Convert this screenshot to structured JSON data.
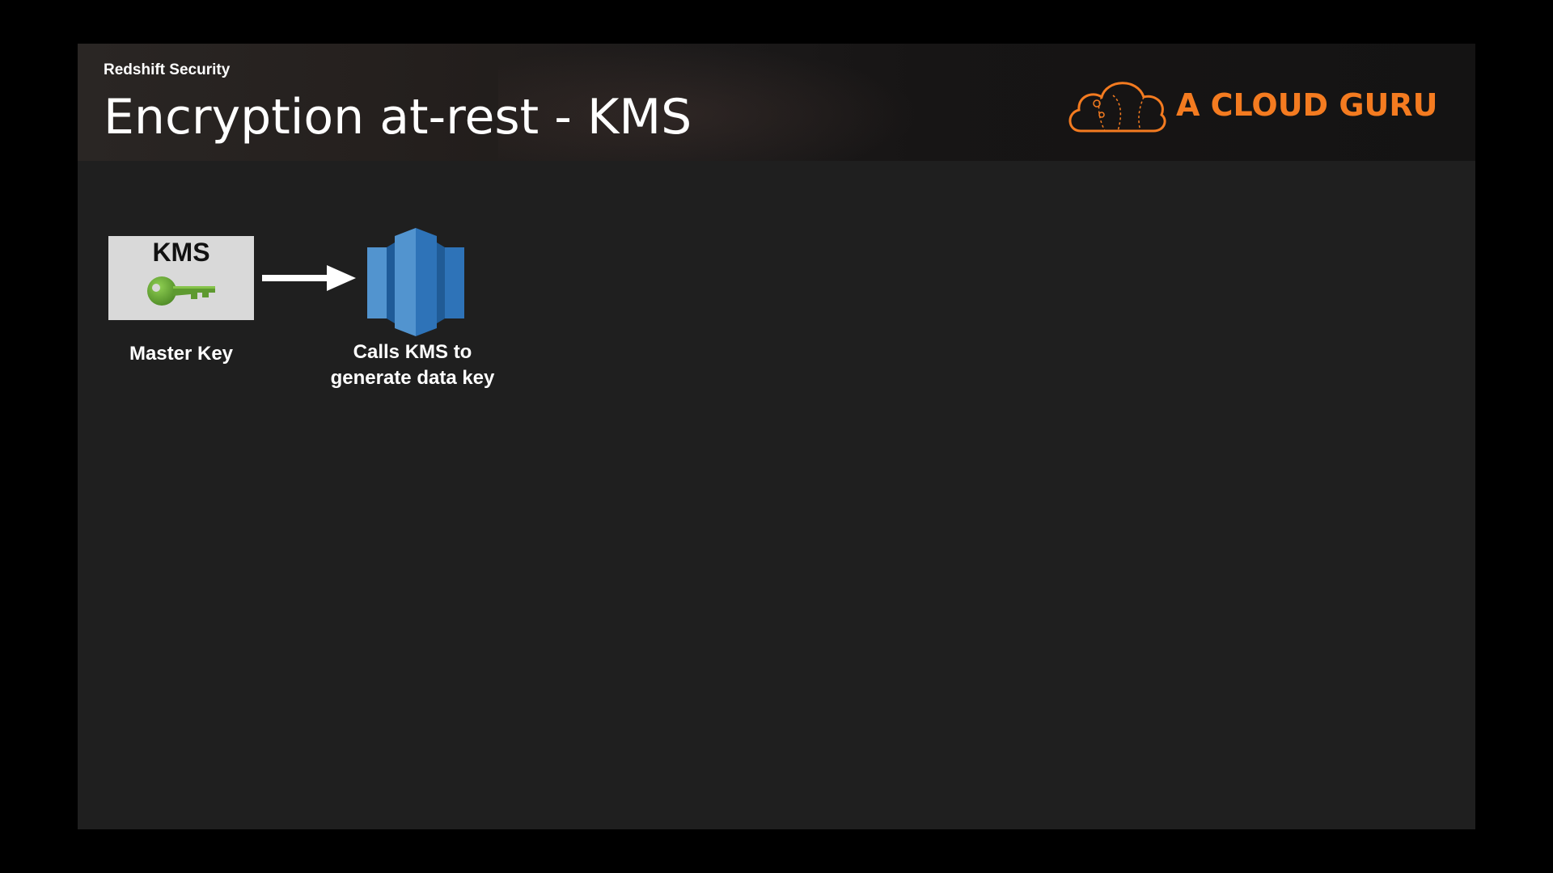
{
  "header": {
    "section_label": "Redshift Security",
    "title": "Encryption at-rest - KMS"
  },
  "logo": {
    "text": "A CLOUD GURU",
    "icon": "cloud-logo-icon",
    "color": "#f47b20"
  },
  "diagram": {
    "kms_box": {
      "title": "KMS",
      "icon": "key-icon",
      "icon_color": "#6aa838",
      "label": "Master Key"
    },
    "arrow": {
      "icon": "right-arrow-icon",
      "color": "#ffffff"
    },
    "redshift": {
      "icon": "redshift-icon",
      "icon_color": "#2e73b8",
      "label_line1": "Calls KMS to",
      "label_line2": "generate data key"
    }
  },
  "colors": {
    "background": "#1f1f1f",
    "outer_frame": "#000000",
    "text": "#ffffff",
    "accent": "#f47b20"
  }
}
